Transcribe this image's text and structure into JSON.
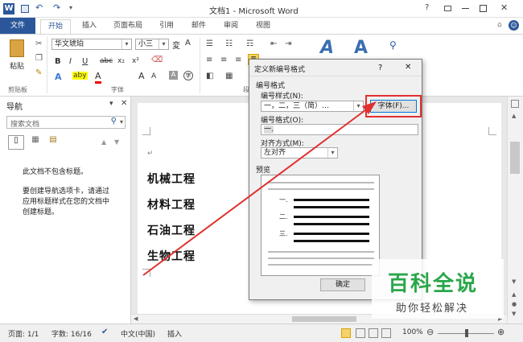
{
  "titlebar": {
    "title": "文档1 - Microsoft Word",
    "word_icon": "W",
    "help": "?"
  },
  "tabs": [
    "文件",
    "开始",
    "插入",
    "页面布局",
    "引用",
    "邮件",
    "审阅",
    "视图"
  ],
  "ribbon": {
    "paste_label": "粘贴",
    "font_name": "华文琥珀",
    "font_size": "小三",
    "bold": "B",
    "italic": "I",
    "underline": "U",
    "strike": "abc",
    "sub": "x₂",
    "sup": "x²",
    "font_color_btn": "A",
    "highlight": "aby",
    "grow": "A",
    "shrink": "A",
    "clipboard_label": "剪贴板",
    "font_label": "字体",
    "para_label": "段",
    "style_a1": "A",
    "style_a2": "A"
  },
  "nav": {
    "title": "导航",
    "search_placeholder": "搜索文档",
    "msg1": "此文档不包含标题。",
    "msg2": "要创建导航选项卡，请通过应用标题样式在您的文档中创建标题。"
  },
  "document": {
    "pilcrow": "↵",
    "headings": [
      "机械工程",
      "材料工程",
      "石油工程",
      "生物工程"
    ]
  },
  "dialog": {
    "title": "定义新编号格式",
    "help": "?",
    "close": "✕",
    "group_label": "编号格式",
    "style_label": "编号样式(N):",
    "style_value": "一，二，三（简）…",
    "font_button": "字体(F)...",
    "format_label": "编号格式(O):",
    "format_value": "一.",
    "align_label": "对齐方式(M):",
    "align_value": "左对齐",
    "preview_label": "预览",
    "preview_items": [
      "一.",
      "二.",
      "三."
    ],
    "ok_button": "确定"
  },
  "watermark": {
    "title": "百科全说",
    "subtitle": "助你轻松解决"
  },
  "status": {
    "page": "页面: 1/1",
    "words": "字数: 16/16",
    "lang": "中文(中国)",
    "mode": "插入",
    "zoom": "100%"
  },
  "colors": {
    "file_tab": "#2b579a",
    "arrow": "#e03030",
    "highlight_box": "#e03030"
  }
}
